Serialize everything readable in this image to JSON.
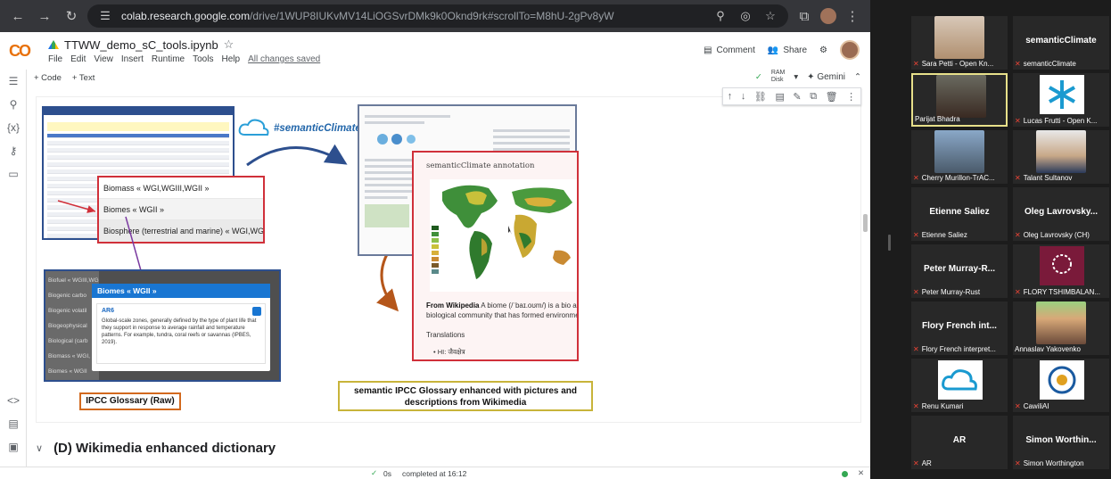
{
  "browser": {
    "url_host": "colab.research.google.com",
    "url_path": "/drive/1WUP8IUKvMV14LiOGSvrDMk9k0Oknd9rk#scrollTo=M8hU-2gPv8yW"
  },
  "colab": {
    "logo": "CO",
    "notebook_name": "TTWW_demo_sC_tools.ipynb",
    "menu": [
      "File",
      "Edit",
      "View",
      "Insert",
      "Runtime",
      "Tools",
      "Help"
    ],
    "save_status": "All changes saved",
    "comment_label": "Comment",
    "share_label": "Share",
    "add_code": "+ Code",
    "add_text": "+ Text",
    "ram_label": "RAM",
    "disk_label": "Disk",
    "gemini_label": "Gemini"
  },
  "figure": {
    "callout_items": [
      "Biomass « WGI,WGIII,WGII »",
      "Biomes « WGII »",
      "Biosphere (terrestrial and marine) « WGI,WGII"
    ],
    "raw_left_items": [
      "Biofuel « WGIII,WGII »",
      "Biogenic carbo",
      "Biogenic volatil",
      "Biogeophysical",
      "Biological (carb",
      "Biomass « WGI,",
      "Biomes « WGII"
    ],
    "glossary_card_title": "Biomes « WGII »",
    "glossary_ar": "AR6",
    "glossary_text": "Global-scale zones, generally defined by the type of plant life that they support in response to average rainfall and temperature patterns. For example, tundra, coral reefs or savannas (IPBES, 2019).",
    "sc_logo_text": "#semanticClimate",
    "annotation_title": "semanticClimate annotation",
    "from_wiki_label": "From Wikipedia",
    "from_wiki_text": "A biome (/ˈbaɪ.oʊm/) is a bio a biological community that has formed environment.",
    "translations_label": "Translations",
    "hi_translation": "• HI: जैवक्षेत्र",
    "label_raw": "IPCC Glossary (Raw)",
    "label_enhanced": "semantic IPCC Glossary enhanced with pictures and descriptions from Wikimedia"
  },
  "section": {
    "title": "(D) Wikimedia enhanced dictionary"
  },
  "status": {
    "elapsed": "0s",
    "completed": "completed at 16:12"
  },
  "participants": [
    {
      "display": "",
      "label": "Sara Petti - Open Kn..."
    },
    {
      "display": "semanticClimate",
      "label": "semanticClimate"
    },
    {
      "display": "",
      "label": "Parijat Bhadra"
    },
    {
      "display": "",
      "label": "Lucas Frutti - Open K..."
    },
    {
      "display": "",
      "label": "Cherry Murillon-TrAC..."
    },
    {
      "display": "",
      "label": "Talant Sultanov"
    },
    {
      "display": "Etienne Saliez",
      "label": "Etienne Saliez"
    },
    {
      "display": "Oleg Lavrovsky...",
      "label": "Oleg Lavrovsky (CH)"
    },
    {
      "display": "Peter Murray-R...",
      "label": "Peter Murray-Rust"
    },
    {
      "display": "",
      "label": "FLORY TSHIMBALAN..."
    },
    {
      "display": "Flory French int...",
      "label": "Flory French interpret..."
    },
    {
      "display": "",
      "label": "Annaslav Yakovenko"
    },
    {
      "display": "",
      "label": "Renu Kumari"
    },
    {
      "display": "",
      "label": "CawiliAI"
    },
    {
      "display": "AR",
      "label": "AR"
    },
    {
      "display": "Simon Worthin...",
      "label": "Simon Worthington"
    }
  ]
}
